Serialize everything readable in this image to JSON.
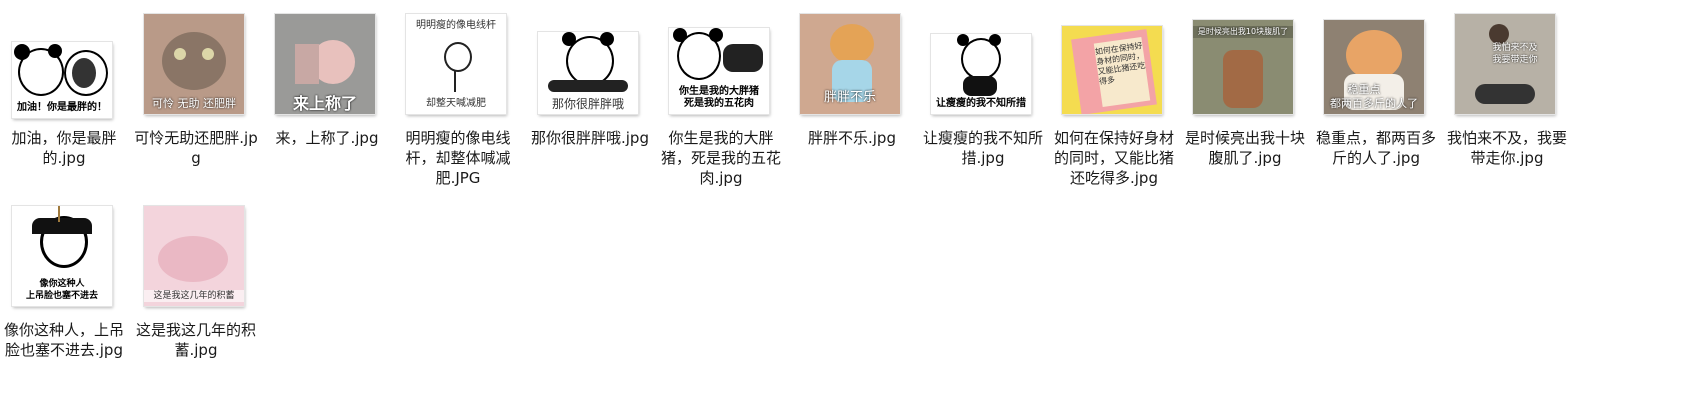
{
  "files": [
    {
      "name": "加油，你是最胖的.jpg",
      "caption": "加油！你是最胖的！"
    },
    {
      "name": "可怜无助还肥胖.jpg",
      "caption": "可怜 无助 还肥胖"
    },
    {
      "name": "来，上称了.jpg",
      "caption": "来上称了"
    },
    {
      "name": "明明瘦的像电线杆，却整体喊减肥.JPG",
      "caption_top": "明明瘦的像电线杆",
      "caption": "却整天喊减肥"
    },
    {
      "name": "那你很胖胖哦.jpg",
      "caption": "那你很胖胖哦"
    },
    {
      "name": "你生是我的大胖猪，死是我的五花肉.jpg",
      "caption": "你生是我的大胖猪",
      "caption2": "死是我的五花肉"
    },
    {
      "name": "胖胖不乐.jpg",
      "caption": "胖胖不乐"
    },
    {
      "name": "让瘦瘦的我不知所措.jpg",
      "caption": "让瘦瘦的我不知所措"
    },
    {
      "name": "如何在保持好身材的同时，又能比猪还吃得多.jpg",
      "caption": "如何在保持好身材的同时，又能比猪还吃得多"
    },
    {
      "name": "是时候亮出我十块腹肌了.jpg",
      "caption": "是时候亮出我10块腹肌了"
    },
    {
      "name": "稳重点，都两百多斤的人了.jpg",
      "caption": "稳重点",
      "caption2": "都两百多斤的人了"
    },
    {
      "name": "我怕来不及，我要带走你.jpg",
      "caption": "我怕来不及",
      "caption2": "我要带走你"
    },
    {
      "name": "像你这种人，上吊脸也塞不进去.jpg",
      "caption": "像你这种人",
      "caption2": "上吊脸也塞不进去"
    },
    {
      "name": "这是我这几年的积蓄.jpg",
      "caption": "这是我这几年的积蓄"
    }
  ]
}
